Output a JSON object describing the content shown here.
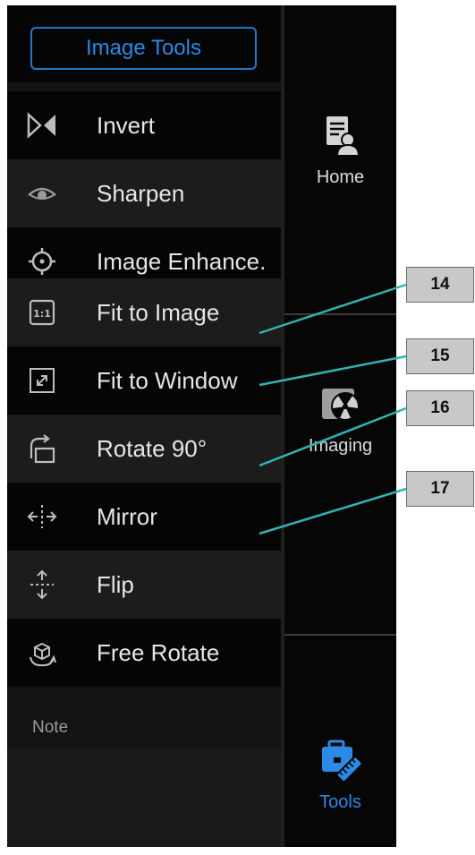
{
  "panel": {
    "title": "Image Tools",
    "note": "Note",
    "items": [
      {
        "label": "Invert",
        "icon": "invert-icon"
      },
      {
        "label": "Sharpen",
        "icon": "eye-icon"
      },
      {
        "label": "Image Enhance.",
        "icon": "crosshair-icon"
      },
      {
        "label": "Fit to Image",
        "icon": "fit-1-1-icon"
      },
      {
        "label": "Fit to Window",
        "icon": "expand-arrows-icon"
      },
      {
        "label": "Rotate 90°",
        "icon": "rotate-icon"
      },
      {
        "label": "Mirror",
        "icon": "mirror-icon"
      },
      {
        "label": "Flip",
        "icon": "flip-icon"
      },
      {
        "label": "Free Rotate",
        "icon": "free-rotate-icon"
      }
    ]
  },
  "nav": {
    "home": {
      "label": "Home",
      "icon": "patient-document-icon"
    },
    "imaging": {
      "label": "Imaging",
      "icon": "radiation-image-icon"
    },
    "tools": {
      "label": "Tools",
      "icon": "toolbox-ruler-icon"
    }
  },
  "callouts": [
    "14",
    "15",
    "16",
    "17"
  ],
  "colors": {
    "accent": "#2a8ae6",
    "panel_bg": "#131313",
    "callout_bg": "#c8c8c8",
    "leader_line": "#2fb3b3"
  }
}
